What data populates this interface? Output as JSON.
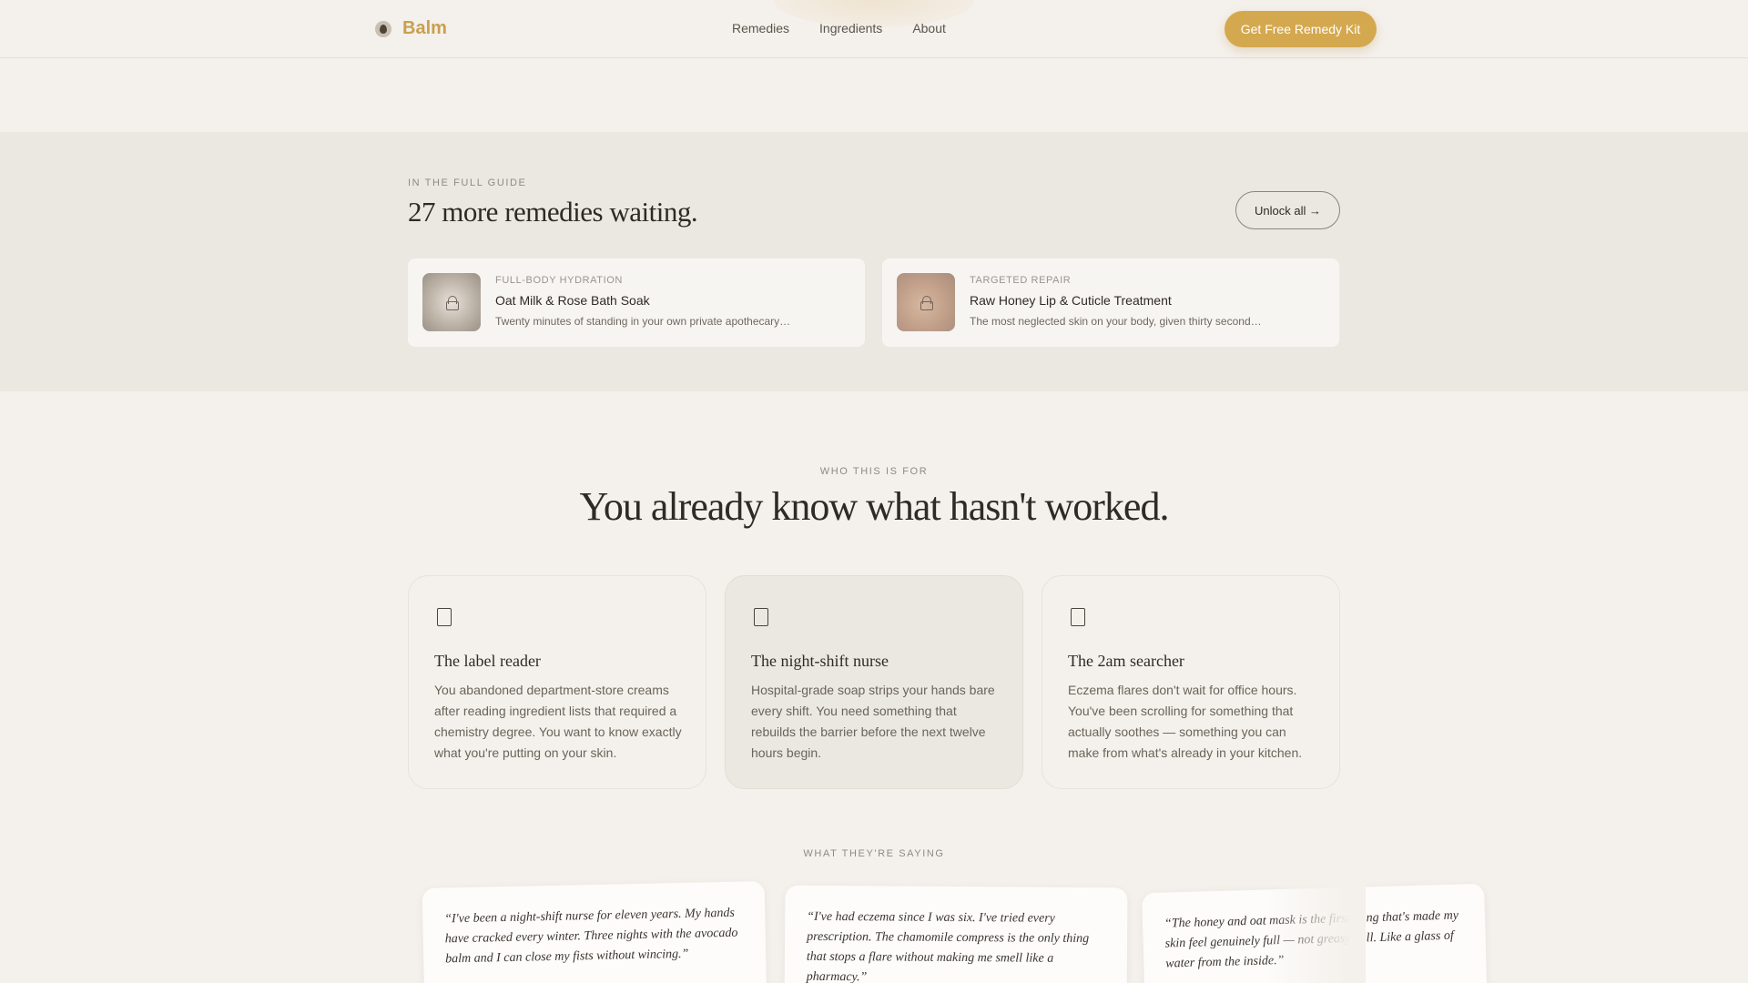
{
  "header": {
    "brand": "Balm",
    "nav": [
      "Remedies",
      "Ingredients",
      "About"
    ],
    "cta": "Get Free Remedy Kit"
  },
  "locked": {
    "eyebrow": "IN THE FULL GUIDE",
    "title": "27 more remedies waiting.",
    "unlock": "Unlock all →",
    "cards": [
      {
        "category": "FULL-BODY HYDRATION",
        "title": "Oat Milk & Rose Bath Soak",
        "desc": "Twenty minutes of standing in your own private apothecary…"
      },
      {
        "category": "TARGETED REPAIR",
        "title": "Raw Honey Lip & Cuticle Treatment",
        "desc": "The most neglected skin on your body, given thirty second…"
      }
    ]
  },
  "who": {
    "eyebrow": "WHO THIS IS FOR",
    "title": "You already know what hasn't worked.",
    "cards": [
      {
        "title": "The label reader",
        "desc": "You abandoned department-store creams after reading ingredient lists that required a chemistry degree. You want to know exactly what you're putting on your skin."
      },
      {
        "title": "The night-shift nurse",
        "desc": "Hospital-grade soap strips your hands bare every shift. You need something that rebuilds the barrier before the next twelve hours begin."
      },
      {
        "title": "The 2am searcher",
        "desc": "Eczema flares don't wait for office hours. You've been scrolling for something that actually soothes — something you can make from what's already in your kitchen."
      }
    ]
  },
  "testimonials": {
    "eyebrow": "WHAT THEY'RE SAYING",
    "quotes": [
      "“I've been a night-shift nurse for eleven years. My hands have cracked every winter. Three nights with the avocado balm and I can close my fists without wincing.”",
      "“I've had eczema since I was six. I've tried every prescription. The chamomile compress is the only thing that stops a flare without making me smell like a pharmacy.”",
      "“The honey and oat mask is the first thing that's made my skin feel genuinely full — not greasy, full. Like a glass of water from the inside.”"
    ]
  },
  "colors": {
    "accent": "#d4a84f",
    "brand": "#c9a04d",
    "background": "#f4f0eb",
    "band": "#ebe8e2"
  }
}
